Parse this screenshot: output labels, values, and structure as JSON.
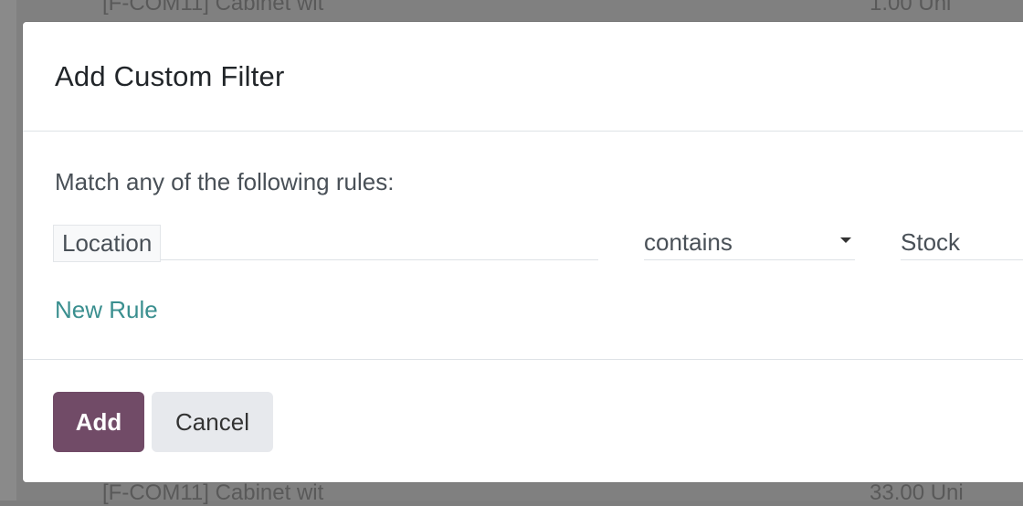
{
  "background": {
    "top_row_text": "[F-COM11] Cabinet wit",
    "top_row_qty": "1.00  Uni",
    "bottom_row_text": "[F-COM11] Cabinet wit",
    "bottom_row_qty": "33.00  Uni"
  },
  "modal": {
    "title": "Add Custom Filter",
    "intro": "Match any of the following rules:",
    "rule": {
      "field": "Location",
      "operator": "contains",
      "value": "Stock"
    },
    "new_rule_label": "New Rule",
    "add_label": "Add",
    "cancel_label": "Cancel"
  },
  "colors": {
    "primary": "#714b67",
    "link": "#3a8f8f",
    "secondary_button": "#e7e9ed"
  }
}
